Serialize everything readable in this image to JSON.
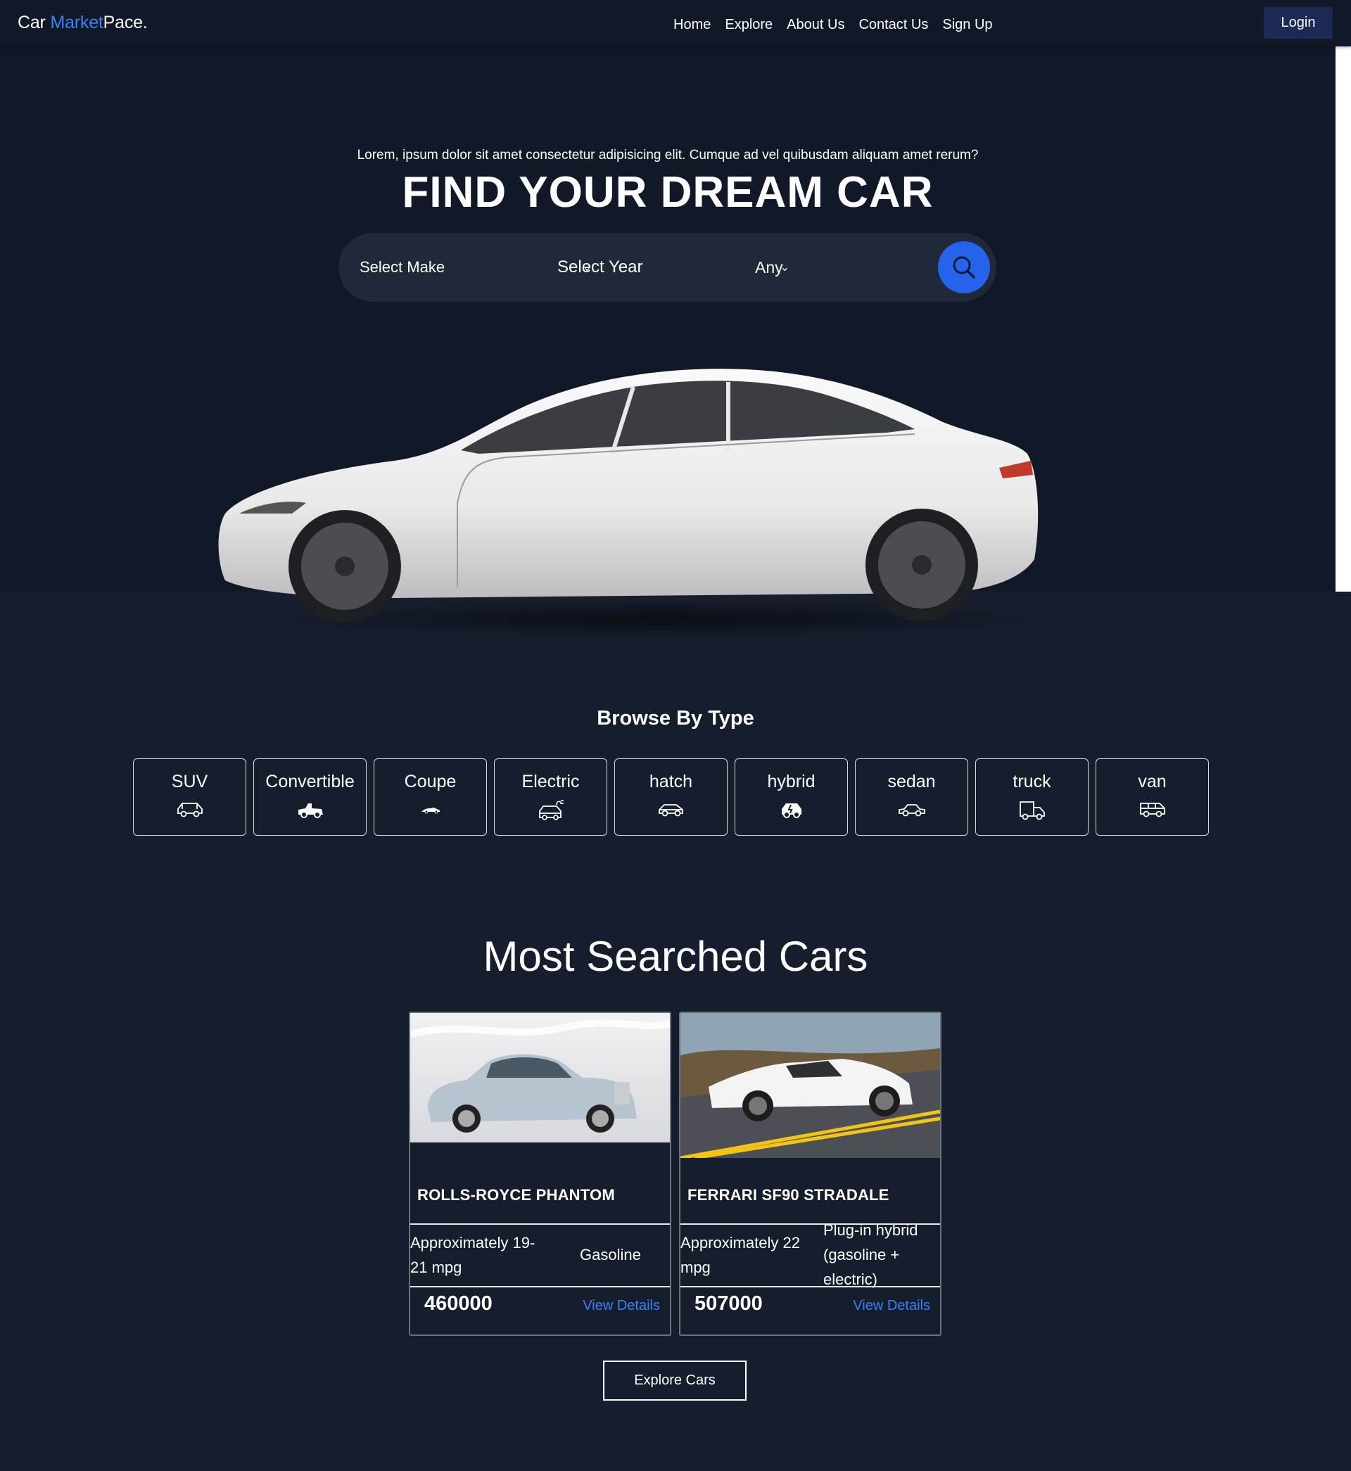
{
  "nav": {
    "logo_prefix": "Car ",
    "logo_accent": "Market",
    "logo_suffix": "Pace.",
    "links": [
      "Home",
      "Explore",
      "About Us",
      "Contact Us",
      "Sign Up"
    ],
    "login": "Login"
  },
  "hero": {
    "tagline": "Lorem, ipsum dolor sit amet consectetur adipisicing elit. Cumque ad vel quibusdam aliquam amet rerum?",
    "title": "FIND YOUR DREAM CAR",
    "search": {
      "make": "Select Make",
      "year": "Select Year",
      "type": "Any",
      "chevron": "⌄",
      "icon": "search-icon"
    }
  },
  "browse": {
    "title": "Browse By Type",
    "types": [
      {
        "name": "SUV",
        "icon": "suv-icon"
      },
      {
        "name": "Convertible",
        "icon": "convertible-icon"
      },
      {
        "name": "Coupe",
        "icon": "coupe-icon"
      },
      {
        "name": "Electric",
        "icon": "electric-car-icon"
      },
      {
        "name": "hatch",
        "icon": "hatch-icon"
      },
      {
        "name": "hybrid",
        "icon": "hybrid-icon"
      },
      {
        "name": "sedan",
        "icon": "sedan-icon"
      },
      {
        "name": "truck",
        "icon": "truck-icon"
      },
      {
        "name": "van",
        "icon": "van-icon"
      }
    ]
  },
  "most_searched": {
    "title": "Most Searched Cars",
    "cars": [
      {
        "name": "ROLLS-ROYCE PHANTOM",
        "mileage": "Approximately 19-21 mpg",
        "fuel": "Gasoline",
        "price": "460000",
        "link": "View Details"
      },
      {
        "name": "FERRARI SF90 STRADALE",
        "mileage": "Approximately 22 mpg",
        "fuel": "Plug-in hybrid (gasoline + electric)",
        "price": "507000",
        "link": "View Details"
      }
    ],
    "explore": "Explore Cars"
  },
  "colors": {
    "page_bg": "#161d2d",
    "hero_bg": "#111827",
    "accent": "#3b82f6",
    "search_button": "#2563eb",
    "login_bg": "#1b2a55"
  }
}
